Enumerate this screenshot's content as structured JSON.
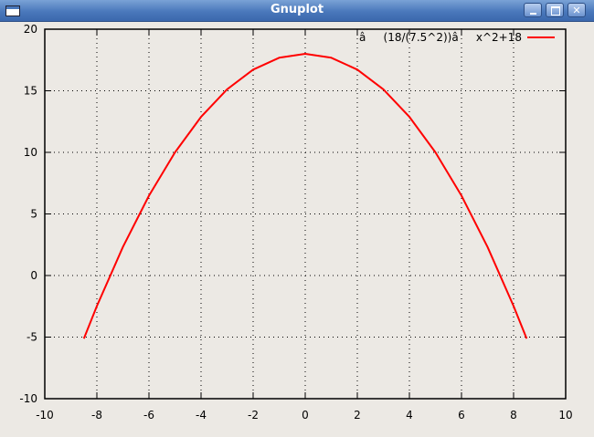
{
  "window": {
    "title": "Gnuplot",
    "icons": {
      "app": "window-icon",
      "minimize": "minimize-icon",
      "maximize": "maximize-icon",
      "close": "close-icon"
    }
  },
  "chart_data": {
    "type": "line",
    "xlim": [
      -10,
      10
    ],
    "ylim": [
      -10,
      20
    ],
    "xticks": [
      -10,
      -8,
      -6,
      -4,
      -2,
      0,
      2,
      4,
      6,
      8,
      10
    ],
    "yticks": [
      -10,
      -5,
      0,
      5,
      10,
      15,
      20
    ],
    "x_tick_labels": [
      "-10",
      "-8",
      "-6",
      "-4",
      "-2",
      "0",
      "2",
      "4",
      "6",
      "8",
      "10"
    ],
    "y_tick_labels": [
      "-10",
      "-5",
      "0",
      "5",
      "10",
      "15",
      "20"
    ],
    "grid": true,
    "legend_position": "top-right",
    "series": [
      {
        "name": "â(18/(7.5^2))âx^2+18",
        "color": "#ff0000",
        "x": [
          -8.5,
          -8,
          -7,
          -6,
          -5,
          -4,
          -3,
          -2,
          -1,
          0,
          1,
          2,
          3,
          4,
          5,
          6,
          7,
          8,
          8.5
        ],
        "y": [
          -5.12,
          -2.48,
          2.32,
          6.48,
          10.0,
          12.88,
          15.12,
          16.72,
          17.68,
          18.0,
          17.68,
          16.72,
          15.12,
          12.88,
          10.0,
          6.48,
          2.32,
          -2.48,
          -5.12
        ]
      }
    ]
  }
}
